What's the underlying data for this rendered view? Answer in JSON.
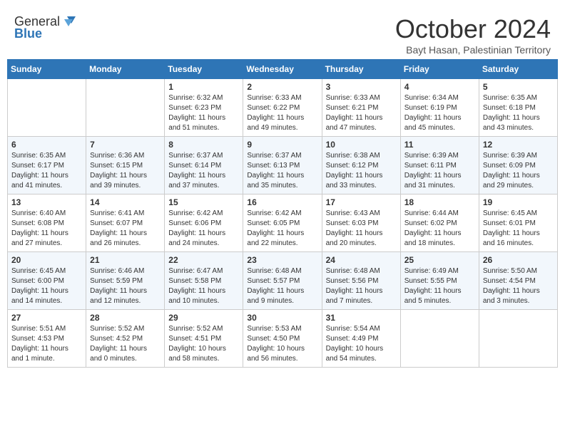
{
  "header": {
    "logo_general": "General",
    "logo_blue": "Blue",
    "month_title": "October 2024",
    "subtitle": "Bayt Hasan, Palestinian Territory"
  },
  "days_of_week": [
    "Sunday",
    "Monday",
    "Tuesday",
    "Wednesday",
    "Thursday",
    "Friday",
    "Saturday"
  ],
  "weeks": [
    [
      {
        "day": "",
        "content": ""
      },
      {
        "day": "",
        "content": ""
      },
      {
        "day": "1",
        "content": "Sunrise: 6:32 AM\nSunset: 6:23 PM\nDaylight: 11 hours and 51 minutes."
      },
      {
        "day": "2",
        "content": "Sunrise: 6:33 AM\nSunset: 6:22 PM\nDaylight: 11 hours and 49 minutes."
      },
      {
        "day": "3",
        "content": "Sunrise: 6:33 AM\nSunset: 6:21 PM\nDaylight: 11 hours and 47 minutes."
      },
      {
        "day": "4",
        "content": "Sunrise: 6:34 AM\nSunset: 6:19 PM\nDaylight: 11 hours and 45 minutes."
      },
      {
        "day": "5",
        "content": "Sunrise: 6:35 AM\nSunset: 6:18 PM\nDaylight: 11 hours and 43 minutes."
      }
    ],
    [
      {
        "day": "6",
        "content": "Sunrise: 6:35 AM\nSunset: 6:17 PM\nDaylight: 11 hours and 41 minutes."
      },
      {
        "day": "7",
        "content": "Sunrise: 6:36 AM\nSunset: 6:15 PM\nDaylight: 11 hours and 39 minutes."
      },
      {
        "day": "8",
        "content": "Sunrise: 6:37 AM\nSunset: 6:14 PM\nDaylight: 11 hours and 37 minutes."
      },
      {
        "day": "9",
        "content": "Sunrise: 6:37 AM\nSunset: 6:13 PM\nDaylight: 11 hours and 35 minutes."
      },
      {
        "day": "10",
        "content": "Sunrise: 6:38 AM\nSunset: 6:12 PM\nDaylight: 11 hours and 33 minutes."
      },
      {
        "day": "11",
        "content": "Sunrise: 6:39 AM\nSunset: 6:11 PM\nDaylight: 11 hours and 31 minutes."
      },
      {
        "day": "12",
        "content": "Sunrise: 6:39 AM\nSunset: 6:09 PM\nDaylight: 11 hours and 29 minutes."
      }
    ],
    [
      {
        "day": "13",
        "content": "Sunrise: 6:40 AM\nSunset: 6:08 PM\nDaylight: 11 hours and 27 minutes."
      },
      {
        "day": "14",
        "content": "Sunrise: 6:41 AM\nSunset: 6:07 PM\nDaylight: 11 hours and 26 minutes."
      },
      {
        "day": "15",
        "content": "Sunrise: 6:42 AM\nSunset: 6:06 PM\nDaylight: 11 hours and 24 minutes."
      },
      {
        "day": "16",
        "content": "Sunrise: 6:42 AM\nSunset: 6:05 PM\nDaylight: 11 hours and 22 minutes."
      },
      {
        "day": "17",
        "content": "Sunrise: 6:43 AM\nSunset: 6:03 PM\nDaylight: 11 hours and 20 minutes."
      },
      {
        "day": "18",
        "content": "Sunrise: 6:44 AM\nSunset: 6:02 PM\nDaylight: 11 hours and 18 minutes."
      },
      {
        "day": "19",
        "content": "Sunrise: 6:45 AM\nSunset: 6:01 PM\nDaylight: 11 hours and 16 minutes."
      }
    ],
    [
      {
        "day": "20",
        "content": "Sunrise: 6:45 AM\nSunset: 6:00 PM\nDaylight: 11 hours and 14 minutes."
      },
      {
        "day": "21",
        "content": "Sunrise: 6:46 AM\nSunset: 5:59 PM\nDaylight: 11 hours and 12 minutes."
      },
      {
        "day": "22",
        "content": "Sunrise: 6:47 AM\nSunset: 5:58 PM\nDaylight: 11 hours and 10 minutes."
      },
      {
        "day": "23",
        "content": "Sunrise: 6:48 AM\nSunset: 5:57 PM\nDaylight: 11 hours and 9 minutes."
      },
      {
        "day": "24",
        "content": "Sunrise: 6:48 AM\nSunset: 5:56 PM\nDaylight: 11 hours and 7 minutes."
      },
      {
        "day": "25",
        "content": "Sunrise: 6:49 AM\nSunset: 5:55 PM\nDaylight: 11 hours and 5 minutes."
      },
      {
        "day": "26",
        "content": "Sunrise: 5:50 AM\nSunset: 4:54 PM\nDaylight: 11 hours and 3 minutes."
      }
    ],
    [
      {
        "day": "27",
        "content": "Sunrise: 5:51 AM\nSunset: 4:53 PM\nDaylight: 11 hours and 1 minute."
      },
      {
        "day": "28",
        "content": "Sunrise: 5:52 AM\nSunset: 4:52 PM\nDaylight: 11 hours and 0 minutes."
      },
      {
        "day": "29",
        "content": "Sunrise: 5:52 AM\nSunset: 4:51 PM\nDaylight: 10 hours and 58 minutes."
      },
      {
        "day": "30",
        "content": "Sunrise: 5:53 AM\nSunset: 4:50 PM\nDaylight: 10 hours and 56 minutes."
      },
      {
        "day": "31",
        "content": "Sunrise: 5:54 AM\nSunset: 4:49 PM\nDaylight: 10 hours and 54 minutes."
      },
      {
        "day": "",
        "content": ""
      },
      {
        "day": "",
        "content": ""
      }
    ]
  ]
}
